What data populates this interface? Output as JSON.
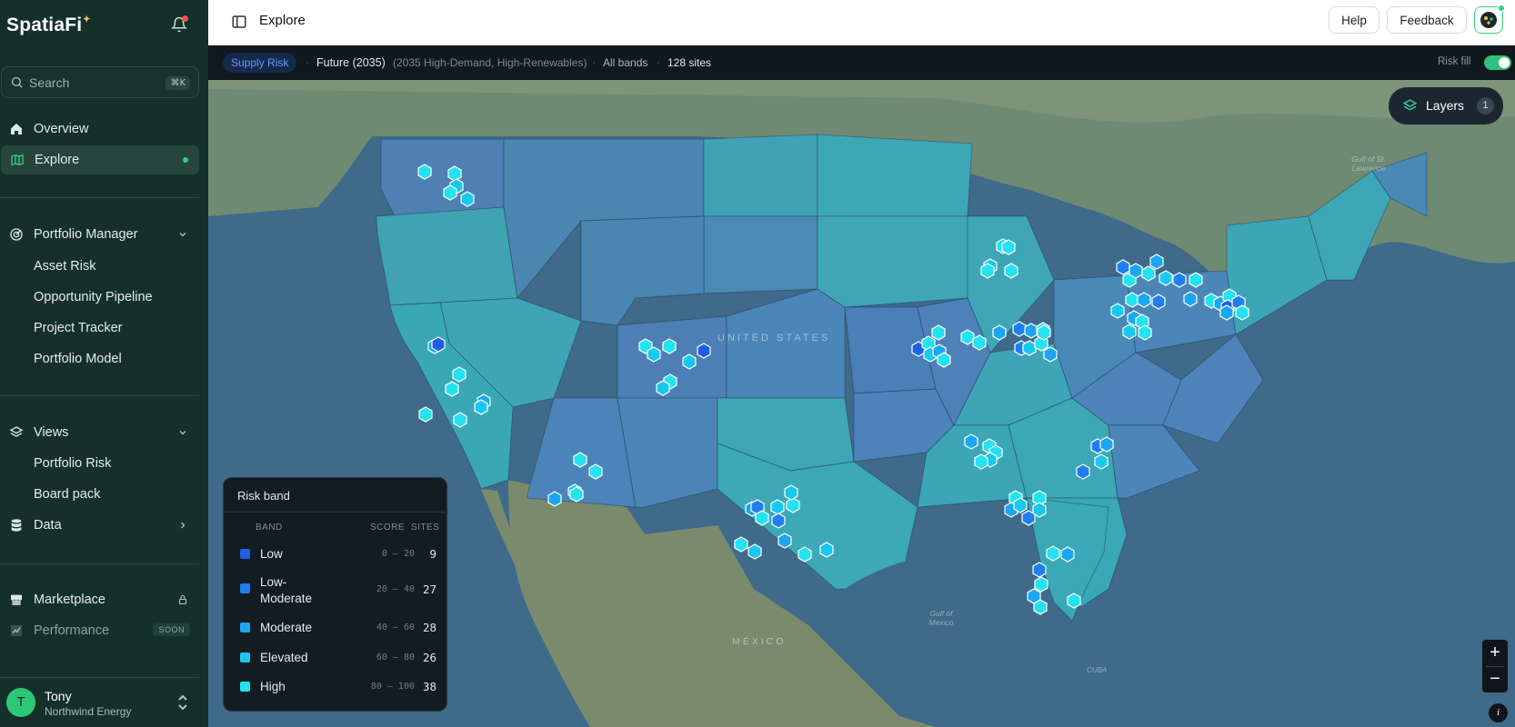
{
  "brand": {
    "name": "SpatiaFi",
    "spark": "✦"
  },
  "search": {
    "placeholder": "Search",
    "shortcut": "⌘K"
  },
  "nav": {
    "overview": "Overview",
    "explore": "Explore",
    "portfolio_manager": "Portfolio Manager",
    "portfolio_sub": [
      "Asset Risk",
      "Opportunity Pipeline",
      "Project Tracker",
      "Portfolio Model"
    ],
    "views": "Views",
    "views_sub": [
      "Portfolio Risk",
      "Board pack"
    ],
    "data": "Data",
    "marketplace": "Marketplace",
    "performance": "Performance",
    "soon_badge": "SOON"
  },
  "user": {
    "initial": "T",
    "name": "Tony",
    "org": "Northwind Energy"
  },
  "header": {
    "title": "Explore",
    "help": "Help",
    "feedback": "Feedback"
  },
  "subbar": {
    "mode": "Supply Risk",
    "scenario": "Future (2035)",
    "scenario_detail": "(2035 High-Demand, High-Renewables)",
    "sep": "·",
    "bands": "All bands",
    "sites": "128 sites",
    "risk_fill_label": "Risk fill",
    "risk_fill_on": true
  },
  "map": {
    "layers_label": "Layers",
    "layers_count": "1",
    "country_label": "UNITED STATES",
    "mexico_label": "MÉXICO",
    "cuba_label": "CUBA",
    "gulf_label": "Gulf of\nMexico",
    "stlawrence_label": "Gulf of St.\nLawrence",
    "zoom_in": "+",
    "zoom_out": "−",
    "info": "i"
  },
  "legend": {
    "title": "Risk band",
    "col_band": "BAND",
    "col_score": "SCORE",
    "col_sites": "SITES",
    "rows": [
      {
        "name": "Low",
        "score": "0 – 20",
        "sites": "9",
        "color": "#1d5fe8"
      },
      {
        "name": "Low-Moderate",
        "score": "20 – 40",
        "sites": "27",
        "color": "#1f7ff0"
      },
      {
        "name": "Moderate",
        "score": "40 – 60",
        "sites": "28",
        "color": "#1aa6f2"
      },
      {
        "name": "Elevated",
        "score": "60 – 80",
        "sites": "26",
        "color": "#18c8f0"
      },
      {
        "name": "High",
        "score": "80 – 100",
        "sites": "38",
        "color": "#23e2f2"
      }
    ]
  }
}
